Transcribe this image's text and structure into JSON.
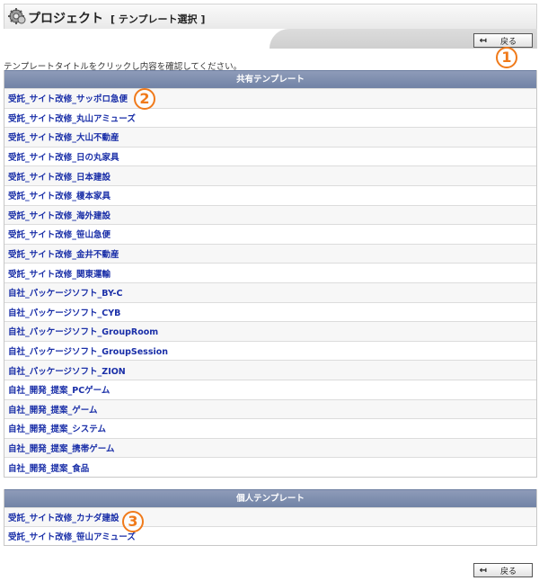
{
  "header": {
    "title": "プロジェクト",
    "subtitle": "[ テンプレート選択 ]",
    "icon": "project-gear-icon"
  },
  "back_button": {
    "label": "戻る",
    "icon": "back-arrow-icon"
  },
  "instruction": "テンプレートタイトルをクリックし内容を確認してください。",
  "shared_templates": {
    "heading": "共有テンプレート",
    "items": [
      "受託_サイト改修_サッポロ急便",
      "受託_サイト改修_丸山アミューズ",
      "受託_サイト改修_大山不動産",
      "受託_サイト改修_日の丸家具",
      "受託_サイト改修_日本建設",
      "受託_サイト改修_榎本家具",
      "受託_サイト改修_海外建設",
      "受託_サイト改修_笹山急便",
      "受託_サイト改修_金井不動産",
      "受託_サイト改修_関東運輸",
      "自社_パッケージソフト_BY-C",
      "自社_パッケージソフト_CYB",
      "自社_パッケージソフト_GroupRoom",
      "自社_パッケージソフト_GroupSession",
      "自社_パッケージソフト_ZION",
      "自社_開発_提案_PCゲーム",
      "自社_開発_提案_ゲーム",
      "自社_開発_提案_システム",
      "自社_開発_提案_携帯ゲーム",
      "自社_開発_提案_食品"
    ]
  },
  "personal_templates": {
    "heading": "個人テンプレート",
    "items": [
      "受託_サイト改修_カナダ建設",
      "受託_サイト改修_笹山アミューズ"
    ]
  },
  "callouts": [
    "1",
    "2",
    "3"
  ],
  "colors": {
    "table_header": "#7b8bad",
    "link": "#1a2fa8",
    "callout": "#f07a1a"
  }
}
